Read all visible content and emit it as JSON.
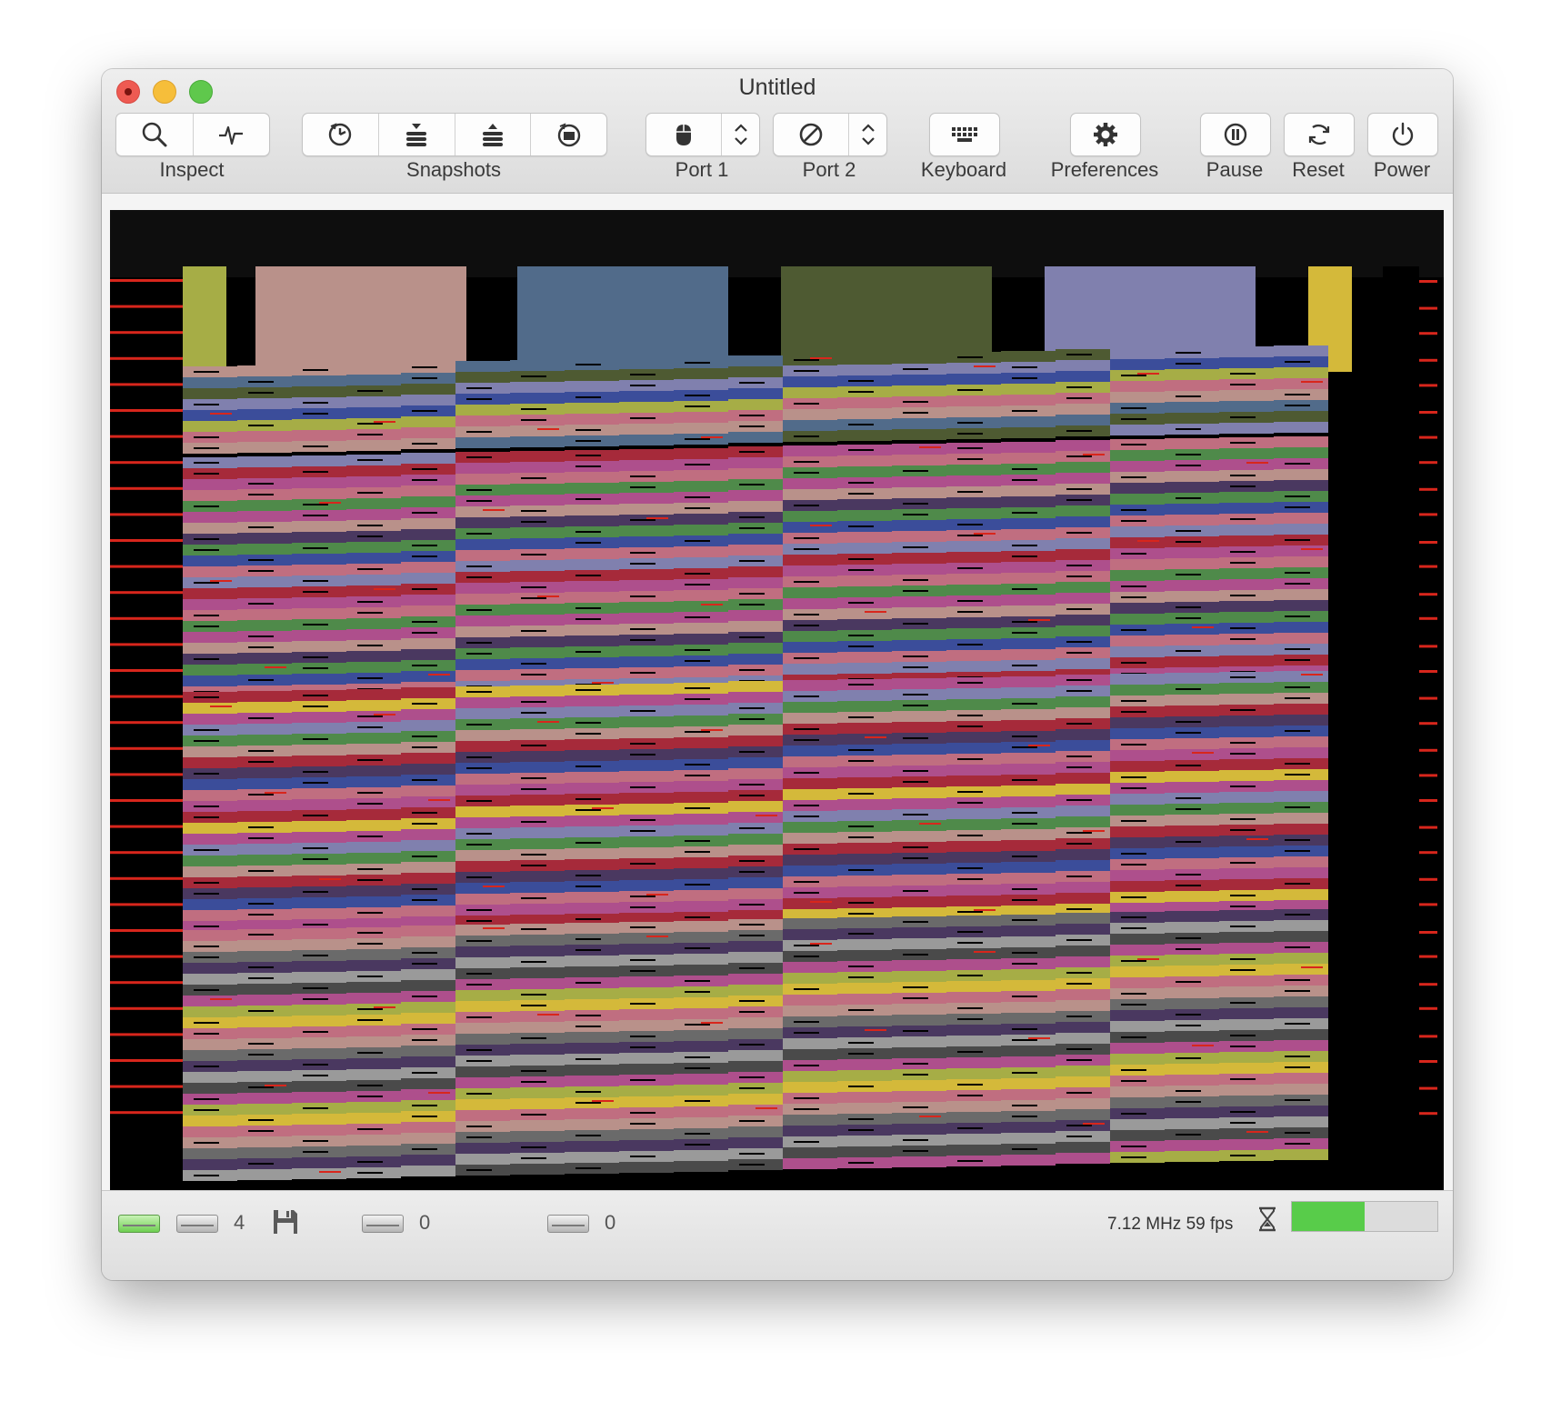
{
  "window": {
    "title": "Untitled"
  },
  "toolbar": {
    "inspect": {
      "label": "Inspect",
      "icons": [
        "magnifier-icon",
        "waveform-icon"
      ]
    },
    "snapshots": {
      "label": "Snapshots",
      "icons": [
        "clock-icon",
        "stack-down-icon",
        "stack-up-icon",
        "folder-revert-icon"
      ]
    },
    "port1": {
      "label": "Port 1",
      "icon": "mouse-icon"
    },
    "port2": {
      "label": "Port 2",
      "icon": "no-device-icon"
    },
    "keyboard": {
      "label": "Keyboard",
      "icon": "keyboard-icon"
    },
    "preferences": {
      "label": "Preferences",
      "icon": "gear-icon"
    },
    "pause": {
      "label": "Pause",
      "icon": "pause-icon"
    },
    "reset": {
      "label": "Reset",
      "icon": "reset-icon"
    },
    "power": {
      "label": "Power",
      "icon": "power-icon"
    }
  },
  "statusbar": {
    "drive8_count": "4",
    "drive9_count": "0",
    "drive10_count": "0",
    "speed": "7.12 MHz 59 fps",
    "warp_progress": 0.5
  },
  "colors": {
    "accent_green": "#58cc4a",
    "border_red": "#d8261c",
    "palette": [
      "#b9918a",
      "#516b8a",
      "#4e5a32",
      "#8080ae",
      "#a6ad46",
      "#d4b93a",
      "#a62a3a",
      "#ae4f8c",
      "#4f8a4a",
      "#3b4d9a",
      "#4a3860",
      "#c06e80",
      "#6a6a6a",
      "#9a9a9a",
      "#4a4a4a",
      "#b4b4b4"
    ]
  }
}
